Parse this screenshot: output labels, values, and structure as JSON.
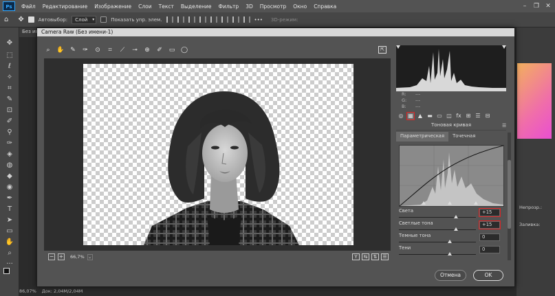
{
  "app": {
    "logo": "Ps",
    "menu": [
      "Файл",
      "Редактирование",
      "Изображение",
      "Слои",
      "Текст",
      "Выделение",
      "Фильтр",
      "3D",
      "Просмотр",
      "Окно",
      "Справка"
    ],
    "window_controls": [
      "–",
      "❐",
      "✕"
    ]
  },
  "options_bar": {
    "autoselect_label": "Автовыбор:",
    "autoselect_value": "Слой",
    "show_controls_label": "Показать упр. элем.",
    "mode_3d_label": "3D-режим:"
  },
  "document": {
    "tab_label": "Без им",
    "zoom_status": "86,07%",
    "doc_info": "Док: 2,04M/2,04M"
  },
  "right_panels": {
    "opacity_label": "Непрозр.:",
    "fill_label": "Заливка:"
  },
  "dialog": {
    "title": "Camera Raw (Без имени-1)",
    "zoom": "66,7%",
    "histogram_rgb": [
      {
        "label": "R:",
        "value": "---"
      },
      {
        "label": "G:",
        "value": "---"
      },
      {
        "label": "B:",
        "value": "---"
      }
    ],
    "panel_title": "Тоновая кривая",
    "tabs": [
      {
        "label": "Параметрическая",
        "active": true
      },
      {
        "label": "Точечная",
        "active": false
      }
    ],
    "sliders": [
      {
        "label": "Света",
        "value": "+15",
        "highlighted": true
      },
      {
        "label": "Светлые тона",
        "value": "+15",
        "highlighted": true
      },
      {
        "label": "Темные тона",
        "value": "0",
        "highlighted": false
      },
      {
        "label": "Тени",
        "value": "0",
        "highlighted": false
      }
    ],
    "cancel_label": "Отмена",
    "ok_label": "OK",
    "view_buttons": [
      "Y",
      "⇆",
      "⇅",
      "☰"
    ]
  },
  "colors": {
    "accent_red": "#d22222",
    "ps_blue": "#31a8ff"
  }
}
